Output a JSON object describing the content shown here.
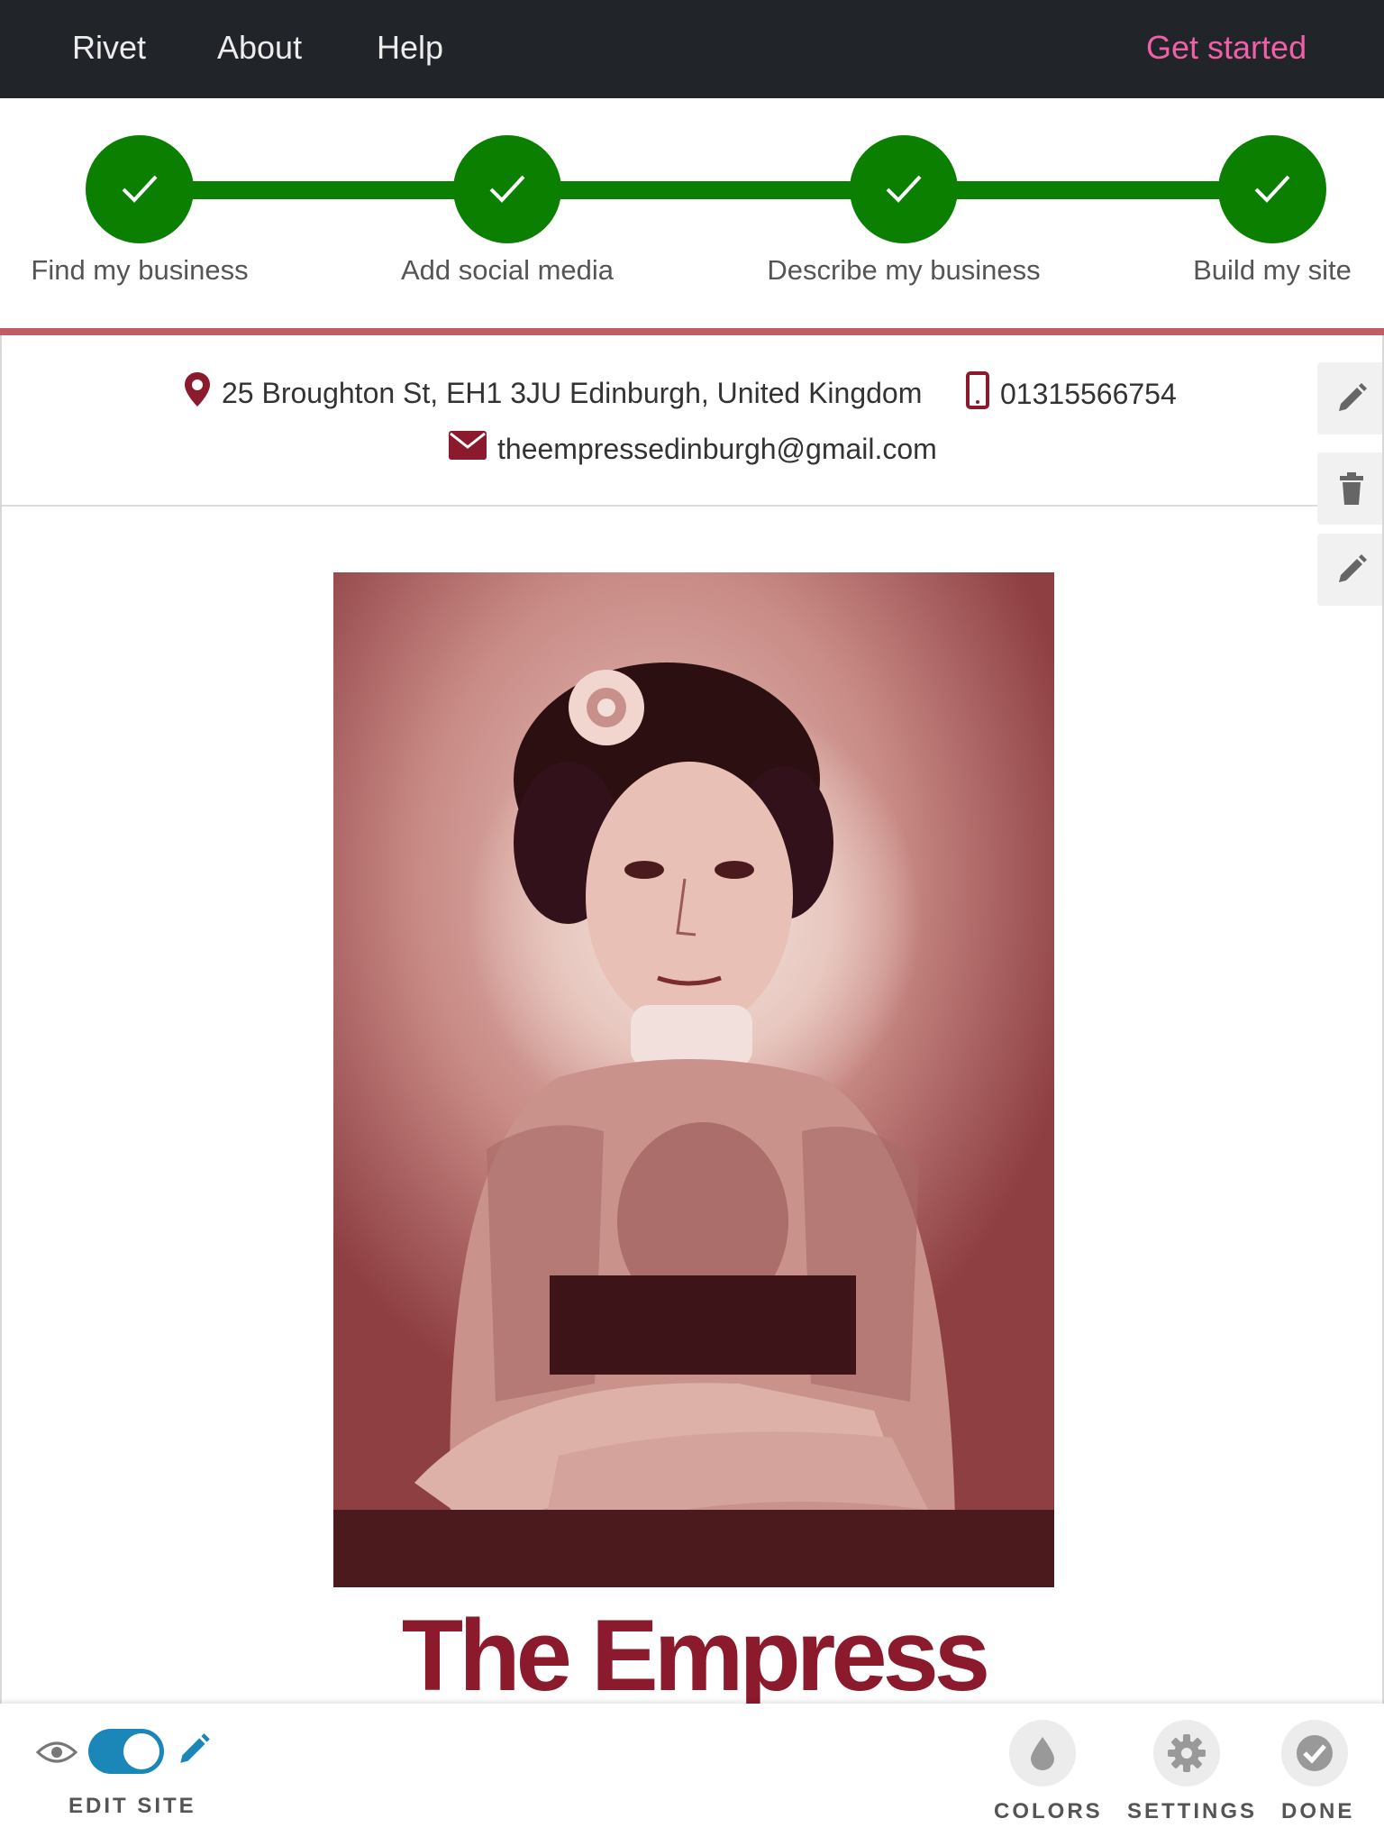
{
  "nav": {
    "brand": "Rivet",
    "about": "About",
    "help": "Help",
    "cta": "Get started",
    "cta_color": "#f060a8"
  },
  "stepper": {
    "accent_color": "#0b8000",
    "steps": [
      {
        "label": "Find my business",
        "status": "complete",
        "icon": "check-icon"
      },
      {
        "label": "Add social media",
        "status": "complete",
        "icon": "check-icon"
      },
      {
        "label": "Describe my business",
        "status": "complete",
        "icon": "check-icon"
      },
      {
        "label": "Build my site",
        "status": "complete",
        "icon": "check-icon"
      }
    ]
  },
  "site": {
    "brand_color": "#8b1a2c",
    "address": "25 Broughton St, EH1 3JU Edinburgh, United Kingdom",
    "phone": "01315566754",
    "email": "theempressedinburgh@gmail.com",
    "title": "The Empress",
    "side_tools": [
      "pencil-icon",
      "trash-icon",
      "pencil-icon"
    ]
  },
  "toolbar": {
    "edit_label": "EDIT SITE",
    "edit_toggle_on": true,
    "colors_label": "COLORS",
    "settings_label": "SETTINGS",
    "done_label": "DONE",
    "toggle_color": "#1a87b8"
  }
}
